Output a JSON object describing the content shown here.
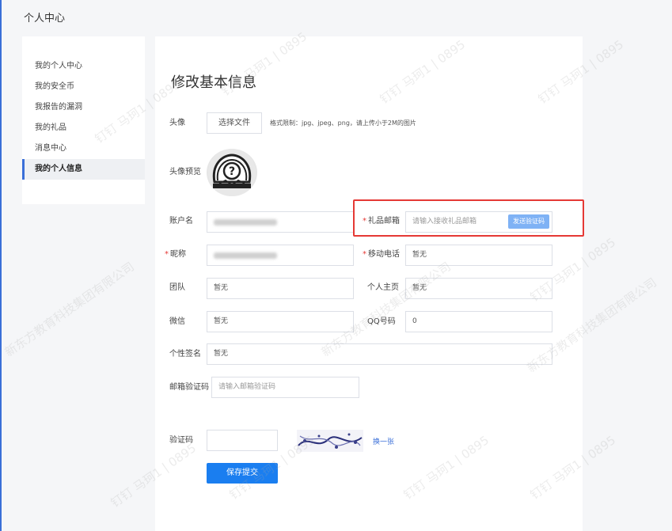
{
  "header": {
    "title": "个人中心"
  },
  "sidebar": {
    "items": [
      {
        "label": "我的个人中心"
      },
      {
        "label": "我的安全币"
      },
      {
        "label": "我报告的漏洞"
      },
      {
        "label": "我的礼品"
      },
      {
        "label": "消息中心"
      },
      {
        "label": "我的个人信息",
        "active": true
      }
    ]
  },
  "form": {
    "title": "修改基本信息",
    "avatar": {
      "label": "头像",
      "button": "选择文件",
      "hint": "格式限制：jpg、jpeg、png，请上传小于2M的图片"
    },
    "preview": {
      "label": "头像预览"
    },
    "account": {
      "label": "账户名"
    },
    "gift_email": {
      "label": "礼品邮箱",
      "placeholder": "请输入接收礼品邮箱",
      "send_button": "发送验证码"
    },
    "nickname": {
      "label": "昵称"
    },
    "mobile": {
      "label": "移动电话",
      "value": "暂无"
    },
    "team": {
      "label": "团队",
      "value": "暂无"
    },
    "homepage": {
      "label": "个人主页",
      "value": "暂无"
    },
    "wechat": {
      "label": "微信",
      "value": "暂无"
    },
    "qq": {
      "label": "QQ号码",
      "value": "0"
    },
    "signature": {
      "label": "个性签名",
      "value": "暂无"
    },
    "email_code": {
      "label": "邮箱验证码",
      "placeholder": "请输入邮箱验证码"
    },
    "captcha": {
      "label": "验证码",
      "refresh": "换一张"
    },
    "save_button": "保存提交"
  },
  "watermarks": [
    "钉钉 马珂1 | 0895",
    "新东方教育科技集团有限公司"
  ],
  "colors": {
    "accent": "#1a7ef0",
    "highlight": "#e53935",
    "required": "#e53935"
  }
}
